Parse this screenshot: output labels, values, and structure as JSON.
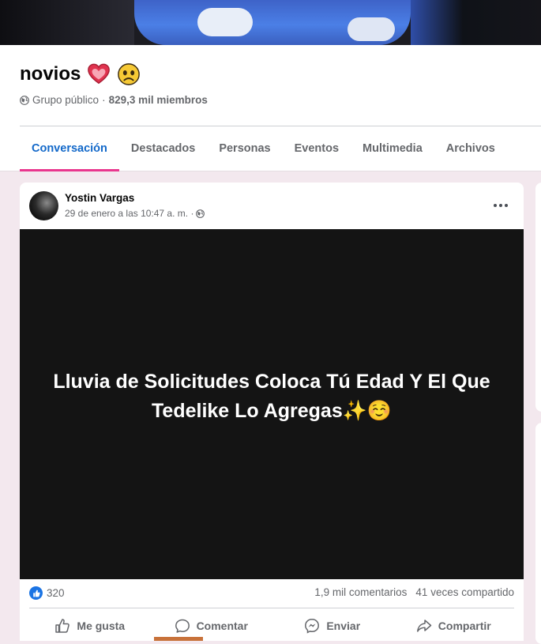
{
  "group": {
    "name": "novios",
    "privacy": "Grupo público",
    "separator": "·",
    "members": "829,3 mil miembros"
  },
  "tabs": [
    {
      "label": "Conversación",
      "active": true
    },
    {
      "label": "Destacados"
    },
    {
      "label": "Personas"
    },
    {
      "label": "Eventos"
    },
    {
      "label": "Multimedia"
    },
    {
      "label": "Archivos"
    }
  ],
  "post": {
    "author": "Yostin Vargas",
    "time": "29 de enero a las 10:47 a. m. ·",
    "text": "Lluvia de Solicitudes Coloca Tú Edad Y El Que Tedelike Lo Agregas✨☺️",
    "reactions_count": "320",
    "comments_count": "1,9 mil comentarios",
    "shares_count": "41 veces compartido",
    "actions": {
      "like": "Me gusta",
      "comment": "Comentar",
      "send": "Enviar",
      "share": "Compartir"
    }
  },
  "colors": {
    "accent_blue": "#1268c9",
    "tab_underline": "#e9368e",
    "like_blue": "#1b74e4",
    "page_bg": "#f3e8ee",
    "media_bg": "#141414"
  },
  "icons": [
    "globe-icon",
    "more-icon",
    "like-icon",
    "comment-icon",
    "messenger-icon",
    "share-icon",
    "heart-emoji",
    "worried-face-emoji"
  ]
}
